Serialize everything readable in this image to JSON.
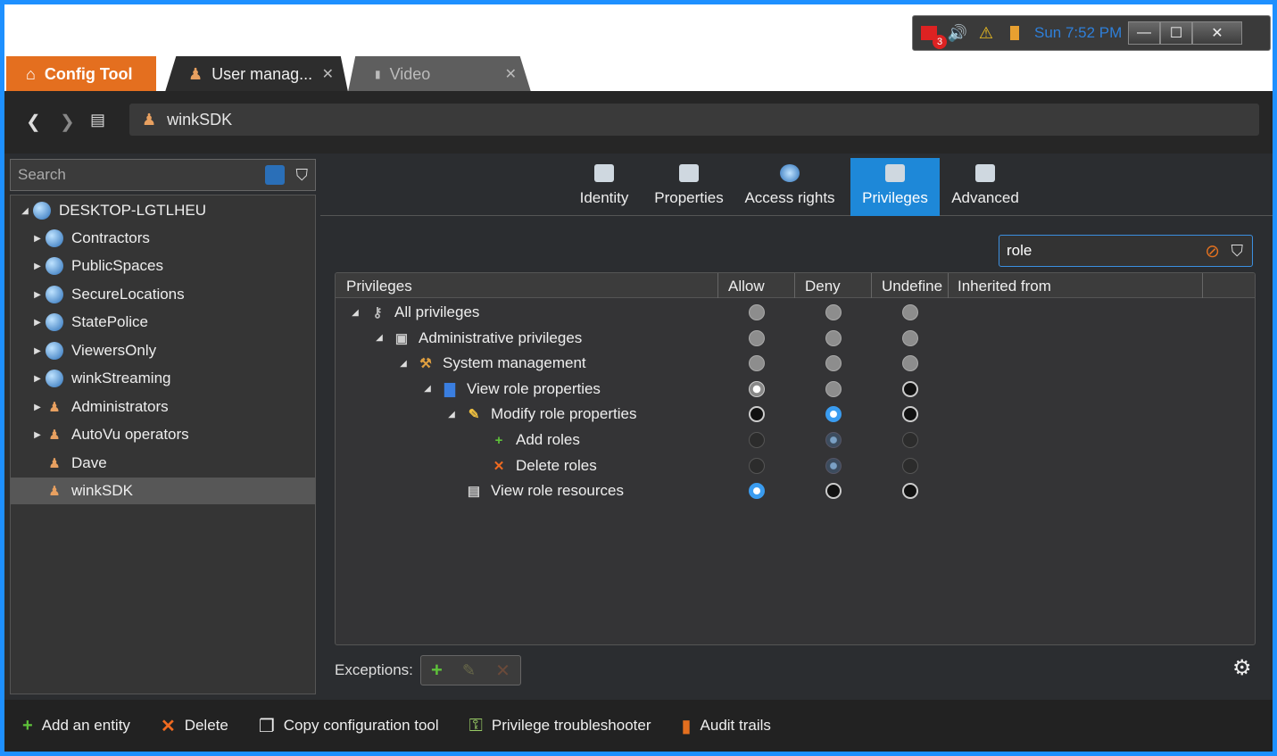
{
  "tray": {
    "badge": "3",
    "time": "Sun 7:52 PM"
  },
  "tabs": {
    "config": "Config Tool",
    "user": "User manag...",
    "video": "Video"
  },
  "address": "winkSDK",
  "search_placeholder": "Search",
  "tree": [
    {
      "label": "DESKTOP-LGTLHEU",
      "icon": "globe-icon"
    },
    {
      "label": "Contractors",
      "icon": "globe-icon"
    },
    {
      "label": "PublicSpaces",
      "icon": "globe-icon"
    },
    {
      "label": "SecureLocations",
      "icon": "globe-icon"
    },
    {
      "label": "StatePolice",
      "icon": "globe-icon"
    },
    {
      "label": "ViewersOnly",
      "icon": "globe-icon"
    },
    {
      "label": "winkStreaming",
      "icon": "globe-icon"
    },
    {
      "label": "Administrators",
      "icon": "admin-group-icon"
    },
    {
      "label": "AutoVu operators",
      "icon": "user-group-icon"
    },
    {
      "label": "Dave",
      "icon": "user-icon"
    },
    {
      "label": "winkSDK",
      "icon": "user-icon",
      "selected": true
    }
  ],
  "ptabs": [
    "Identity",
    "Properties",
    "Access rights",
    "Privileges",
    "Advanced"
  ],
  "active_ptab": "Privileges",
  "filter_value": "role",
  "columns": [
    "Privileges",
    "Allow",
    "Deny",
    "Undefine",
    "Inherited from"
  ],
  "privileges": [
    {
      "label": "All privileges",
      "icon": "keys-icon",
      "allow": "gray",
      "deny": "gray",
      "undefine": "gray"
    },
    {
      "label": "Administrative privileges",
      "icon": "admin-card-icon",
      "allow": "gray",
      "deny": "gray",
      "undefine": "gray"
    },
    {
      "label": "System management",
      "icon": "wrench-icon",
      "allow": "gray",
      "deny": "gray",
      "undefine": "gray"
    },
    {
      "label": "View role properties",
      "icon": "role-icon",
      "allow": "white",
      "deny": "gray",
      "undefine": "black"
    },
    {
      "label": "Modify role properties",
      "icon": "pencil-icon",
      "allow": "black",
      "deny": "blue",
      "undefine": "black"
    },
    {
      "label": "Add roles",
      "icon": "plus-icon",
      "allow": "dim",
      "deny": "dimblue",
      "undefine": "dim"
    },
    {
      "label": "Delete roles",
      "icon": "x-icon",
      "allow": "dim",
      "deny": "dimblue",
      "undefine": "dim"
    },
    {
      "label": "View role resources",
      "icon": "resources-icon",
      "allow": "blue",
      "deny": "black",
      "undefine": "black"
    }
  ],
  "exceptions_label": "Exceptions:",
  "bottom": [
    "Add an entity",
    "Delete",
    "Copy configuration tool",
    "Privilege troubleshooter",
    "Audit trails"
  ],
  "colors": {
    "accent": "#1e88d8",
    "orange": "#e46f1f"
  }
}
